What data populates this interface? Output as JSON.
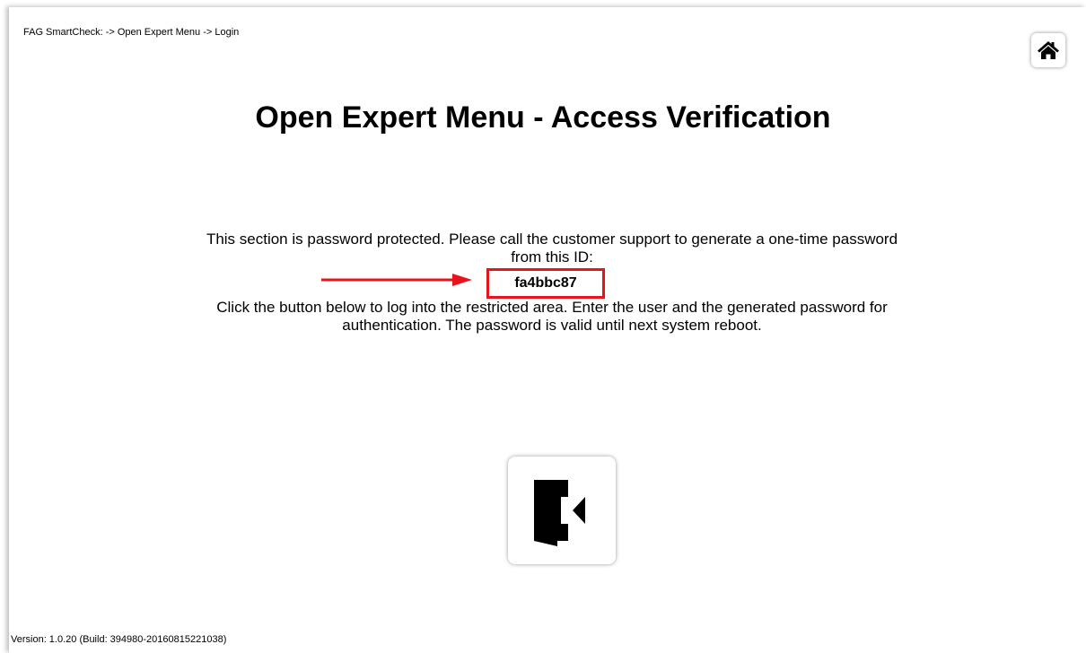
{
  "breadcrumb": "FAG SmartCheck: -> Open Expert Menu -> Login",
  "title": "Open Expert Menu - Access Verification",
  "info": {
    "paragraph1": "This section is password protected. Please call the customer support to generate a one-time password from this ID:",
    "device_id": "fa4bbc87",
    "paragraph2": "Click the button below to log into the restricted area. Enter the user and the generated password for authentication. The password is valid until next system reboot."
  },
  "icons": {
    "home": "home-icon",
    "login": "door-enter-icon",
    "annotation": "arrow-right-icon"
  },
  "colors": {
    "highlight": "#e8141c",
    "text": "#000000",
    "background": "#ffffff"
  },
  "version": "Version: 1.0.20 (Build: 394980-20160815221038)"
}
